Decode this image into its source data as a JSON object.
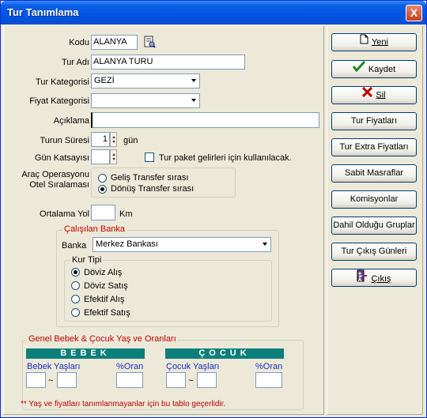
{
  "window": {
    "title": "Tur Tanımlama",
    "close": "X"
  },
  "form": {
    "kodu_label": "Kodu",
    "kodu_value": "ALANYA",
    "turadi_label": "Tur Adı",
    "turadi_value": "ALANYA TURU",
    "turkategori_label": "Tur Kategorisi",
    "turkategori_value": "GEZİ",
    "fiyatkategori_label": "Fiyat Kategorisi",
    "fiyatkategori_value": "",
    "aciklama_label": "Açıklama",
    "aciklama_value": "",
    "turun_suresi_label": "Turun Süresi",
    "turun_suresi_value": "1",
    "turun_suresi_unit": "gün",
    "gun_katsayisi_label": "Gün Katsayısı",
    "gun_katsayisi_value": "",
    "paket_checkbox_label": "Tur paket gelirleri için kullanılacak.",
    "arac_label_1": "Araç Operasyonu",
    "arac_label_2": "Otel Sıralaması",
    "radio_gelis": "Geliş Transfer sırası",
    "radio_donus": "Dönüş Transfer sırası",
    "ortalama_yol_label": "Ortalama Yol",
    "ortalama_yol_value": "",
    "ortalama_yol_unit": "Km"
  },
  "banka": {
    "group_title": "Çalışılan Banka",
    "label": "Banka",
    "value": "Merkez Bankası",
    "kur_tipi_title": "Kur Tipi",
    "options": [
      "Döviz Alış",
      "Döviz Satış",
      "Efektif Alış",
      "Efektif Satış"
    ],
    "selected": 0
  },
  "bebek_cocuk": {
    "group_title": "Genel Bebek & Çocuk Yaş ve Oranları",
    "bebek_header": "BEBEK",
    "cocuk_header": "ÇOCUK",
    "bebek_yaslari": "Bebek Yaşları",
    "cocuk_yaslari": "Çocuk Yaşları",
    "oran": "%Oran",
    "tilde": "~",
    "note": "** Yaş ve fiyatları tanımlanmayanlar için bu tablo geçerlidir."
  },
  "buttons": [
    {
      "label": "Yeni",
      "icon": "new-document-icon"
    },
    {
      "label": "Kaydet",
      "icon": "checkmark-icon"
    },
    {
      "label": "Sil",
      "icon": "delete-x-icon"
    },
    {
      "label": "Tur Fiyatları",
      "icon": ""
    },
    {
      "label": "Tur Extra Fiyatları",
      "icon": ""
    },
    {
      "label": "Sabit Masraflar",
      "icon": ""
    },
    {
      "label": "Komisyonlar",
      "icon": ""
    },
    {
      "label": "Dahil Olduğu Gruplar",
      "icon": ""
    },
    {
      "label": "Tur Çıkış Günleri",
      "icon": ""
    },
    {
      "label": "Çıkış",
      "icon": "exit-door-icon"
    }
  ],
  "colors": {
    "titlebar": "#0054e3",
    "accent_red": "#c00000",
    "teal_header": "#0b7f7a",
    "link_blue": "#1a2ccb"
  }
}
